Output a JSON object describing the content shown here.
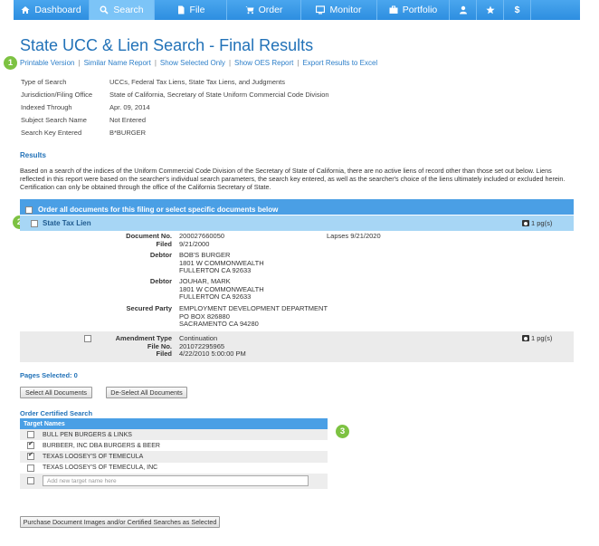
{
  "nav": {
    "items": [
      {
        "label": "Dashboard",
        "icon": "home-icon"
      },
      {
        "label": "Search",
        "icon": "search-icon"
      },
      {
        "label": "File",
        "icon": "file-icon"
      },
      {
        "label": "Order",
        "icon": "cart-icon"
      },
      {
        "label": "Monitor",
        "icon": "monitor-icon"
      },
      {
        "label": "Portfolio",
        "icon": "briefcase-icon"
      },
      {
        "label": "",
        "icon": "user-icon"
      },
      {
        "label": "",
        "icon": "star-icon"
      },
      {
        "label": "$",
        "icon": "dollar-icon"
      }
    ],
    "active_index": 1
  },
  "page": {
    "title": "State UCC & Lien Search - Final Results",
    "badges": [
      "1",
      "2",
      "2",
      "3"
    ]
  },
  "links": [
    "Printable Version",
    "Similar Name Report",
    "Show Selected Only",
    "Show OES Report",
    "Export Results to Excel"
  ],
  "search_info": [
    {
      "label": "Type of Search",
      "value": "UCCs, Federal Tax Liens, State Tax Liens, and Judgments"
    },
    {
      "label": "Jurisdiction/Filing Office",
      "value": "State of California, Secretary of State Uniform Commercial Code Division"
    },
    {
      "label": "Indexed Through",
      "value": "Apr. 09, 2014"
    },
    {
      "label": "Subject Search Name",
      "value": "Not Entered"
    },
    {
      "label": "Search Key Entered",
      "value": "B*BURGER"
    }
  ],
  "results": {
    "heading": "Results",
    "text": "Based on a search of the indices of the Uniform Commercial Code Division of the Secretary of State of California, there are no active liens of record other than those set out below. Liens reflected in this report were based on the searcher's individual search parameters, the search key entered, as well as the searcher's choice of the liens ultimately included or excluded herein. Certification can only be obtained through the office of the California Secretary of State.",
    "order_all_label": "Order all documents for this filing or select specific documents below"
  },
  "lien": {
    "type": "State Tax Lien",
    "pages": "1 pg(s)",
    "document_no_label": "Document No.",
    "document_no": "200027660050",
    "filed_label": "Filed",
    "filed": "9/21/2000",
    "lapses": "Lapses 9/21/2020",
    "debtor_label": "Debtor",
    "debtor1": [
      "BOB'S BURGER",
      "1801 W COMMONWEALTH",
      "FULLERTON CA 92633"
    ],
    "debtor2": [
      "JOUHAR, MARK",
      "1801 W COMMONWEALTH",
      "FULLERTON CA 92633"
    ],
    "secured_label": "Secured Party",
    "secured": [
      "EMPLOYMENT DEVELOPMENT DEPARTMENT",
      "PO BOX 826880",
      "SACRAMENTO CA 94280"
    ]
  },
  "amendment": {
    "type_label": "Amendment Type",
    "type": "Continuation",
    "file_no_label": "File No.",
    "file_no": "201072295965",
    "filed_label": "Filed",
    "filed": "4/22/2010 5:00:00 PM",
    "pages": "1 pg(s)"
  },
  "selection": {
    "pages_selected": "Pages Selected: 0",
    "select_all": "Select All Documents",
    "deselect_all": "De-Select All Documents"
  },
  "certified": {
    "heading": "Order Certified Search",
    "table_header": "Target Names",
    "rows": [
      {
        "name": "BULL PEN BURGERS & LINKS",
        "checked": false
      },
      {
        "name": "BURBEER, INC DBA BURGERS & BEER",
        "checked": true
      },
      {
        "name": "TEXAS LOOSEY'S OF TEMECULA",
        "checked": true
      },
      {
        "name": "TEXAS LOOSEY'S OF TEMECULA, INC",
        "checked": false
      }
    ],
    "new_placeholder": "Add new target name here",
    "purchase_label": "Purchase Document Images and/or Certified Searches as Selected"
  },
  "colors": {
    "nav_bg": "#3d9beb",
    "title": "#2272b8",
    "link": "#2d7fc9",
    "badge": "#7dc242",
    "bar": "#4a9fe5",
    "lien_bar": "#a7d6f5"
  }
}
